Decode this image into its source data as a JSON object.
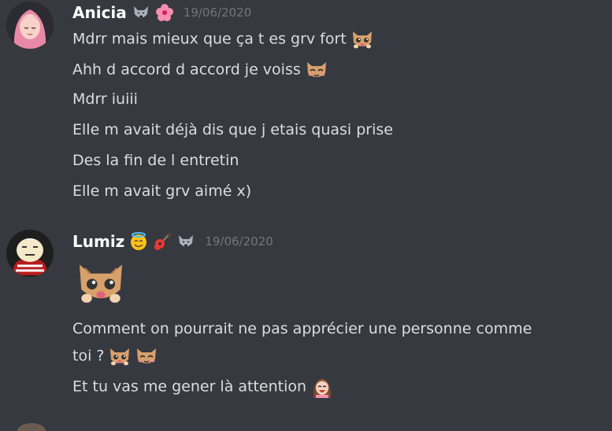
{
  "messages": [
    {
      "author": "Anicia",
      "timestamp": "19/06/2020",
      "badges": [
        "wolf-icon",
        "hibiscus-icon"
      ],
      "lines": [
        "Mdrr mais mieux que ça t es grv fort",
        "Ahh d accord d accord je voiss",
        "Mdrr iuiii",
        "Elle m avait déjà dis que j etais quasi prise",
        "Des la fin de l entretin",
        "Elle m avait grv aimé x)"
      ]
    },
    {
      "author": "Lumiz",
      "timestamp": "19/06/2020",
      "badges": [
        "smiling-halo-icon",
        "guitar-icon",
        "wolf-icon"
      ],
      "lines": [
        "Comment on pourrait ne pas apprécier une personne comme",
        "toi ?",
        "Et tu vas me gener là attention"
      ]
    }
  ],
  "colors": {
    "background": "#36393f",
    "text": "#dcddde",
    "username": "#ffffff",
    "timestamp": "#72767d"
  }
}
